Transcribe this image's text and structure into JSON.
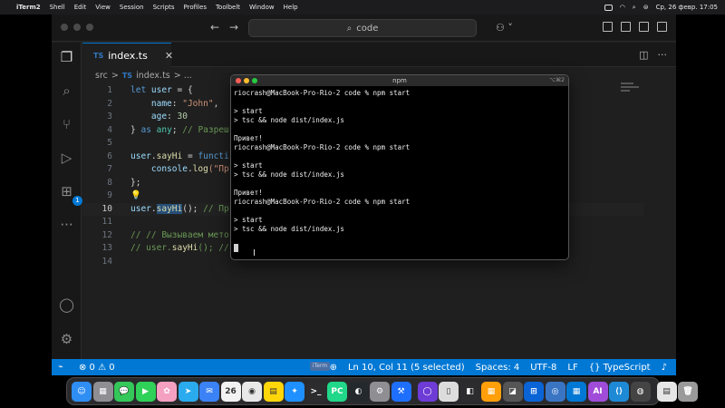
{
  "menubar": {
    "app": "iTerm2",
    "items": [
      "Shell",
      "Edit",
      "View",
      "Session",
      "Scripts",
      "Profiles",
      "Toolbelt",
      "Window",
      "Help"
    ],
    "datetime": "Ср, 26 февр.  17:05"
  },
  "vscode": {
    "command_center": "code",
    "tab": {
      "badge": "TS",
      "label": "index.ts",
      "close": "✕"
    },
    "breadcrumb": {
      "folder": "src",
      "sep": ">",
      "badge": "TS",
      "file": "index.ts",
      "rest": "> ..."
    },
    "activity_badge": "1"
  },
  "code_lines": [
    {
      "n": "1"
    },
    {
      "n": "2"
    },
    {
      "n": "3"
    },
    {
      "n": "4"
    },
    {
      "n": "5"
    },
    {
      "n": "6"
    },
    {
      "n": "7"
    },
    {
      "n": "8"
    },
    {
      "n": "9"
    },
    {
      "n": "10"
    },
    {
      "n": "11"
    },
    {
      "n": "12"
    },
    {
      "n": "13"
    },
    {
      "n": "14"
    }
  ],
  "code": {
    "l1_kw": "let",
    "l1_var": "user",
    "l1_pun": " = {",
    "l2_prop": "name",
    "l2_str": "\"John\"",
    "l3_prop": "age",
    "l3_num": "30",
    "l4_pun": "}",
    "l4_kw": "as",
    "l4_ty": "any",
    "l4_com": "// Разреш",
    "l6_var": "user",
    "l6_fn": "sayHi",
    "l6_kw": "functi",
    "l7_var": "console",
    "l7_fn": "log",
    "l7_str": "(\"Пр",
    "l8_pun": "};",
    "l9_bulb": "💡",
    "l10_var": "user",
    "l10_fn": "sayHi",
    "l10_pun": "();",
    "l10_com": "// Пр",
    "l12_com": "// // Вызываем мето",
    "l13_com": "// user.",
    "l13_fn": "sayHi",
    "l13_com2": "(); //"
  },
  "statusbar": {
    "remote_icon": "⌁",
    "problems": "⊗ 0 ⚠ 0",
    "position": "Ln 10, Col 11 (5 selected)",
    "spaces": "Spaces: 4",
    "encoding": "UTF-8",
    "eol": "LF",
    "language": "{} TypeScript",
    "bell": "🔔"
  },
  "terminal": {
    "title": "npm",
    "shortcut": "⌥⌘2",
    "lines": [
      "riocrash@MacBook-Pro-Rio-2 code % npm start",
      "",
      "> start",
      "> tsc && node dist/index.js",
      "",
      "Привет!",
      "riocrash@MacBook-Pro-Rio-2 code % npm start",
      "",
      "> start",
      "> tsc && node dist/index.js",
      "",
      "Привет!",
      "riocrash@MacBook-Pro-Rio-2 code % npm start",
      "",
      "> start",
      "> tsc && node dist/index.js",
      ""
    ]
  },
  "overlay_label": "iTerm",
  "dock": {
    "apps": [
      {
        "name": "finder",
        "color": "#2f8ef4",
        "glyph": "☺"
      },
      {
        "name": "launchpad",
        "color": "#8e8e93",
        "glyph": "▦"
      },
      {
        "name": "messages",
        "color": "#34c759",
        "glyph": "💬"
      },
      {
        "name": "facetime",
        "color": "#30d158",
        "glyph": "▶"
      },
      {
        "name": "photos",
        "color": "#f4a0c0",
        "glyph": "✿"
      },
      {
        "name": "telegram",
        "color": "#2aabee",
        "glyph": "➤"
      },
      {
        "name": "mail",
        "color": "#3b82f6",
        "glyph": "✉"
      },
      {
        "name": "calendar",
        "color": "#f2f2f2",
        "glyph": "26"
      },
      {
        "name": "chrome",
        "color": "#e8e8e8",
        "glyph": "◉"
      },
      {
        "name": "notes",
        "color": "#ffd60a",
        "glyph": "▤"
      },
      {
        "name": "safari",
        "color": "#1e90ff",
        "glyph": "✦"
      },
      {
        "name": "terminal",
        "color": "#2c2c2e",
        "glyph": ">_"
      },
      {
        "name": "pycharm",
        "color": "#21d789",
        "glyph": "PC"
      },
      {
        "name": "github",
        "color": "#24292e",
        "glyph": "◐"
      },
      {
        "name": "settings",
        "color": "#8e8e93",
        "glyph": "⚙"
      },
      {
        "name": "xcode-instruments",
        "color": "#1f6fff",
        "glyph": "⚒"
      },
      {
        "name": "sep1",
        "color": "",
        "glyph": ""
      },
      {
        "name": "app-purple",
        "color": "#6e3bd6",
        "glyph": "◯"
      },
      {
        "name": "preview",
        "color": "#dcdcdc",
        "glyph": "▯"
      },
      {
        "name": "app-dark",
        "color": "#2c2c2e",
        "glyph": "◧"
      },
      {
        "name": "app-orange",
        "color": "#ff9f0a",
        "glyph": "▦"
      },
      {
        "name": "app-gray",
        "color": "#555555",
        "glyph": "◪"
      },
      {
        "name": "windows",
        "color": "#0a64d6",
        "glyph": "⊞"
      },
      {
        "name": "app-blue",
        "color": "#3a75c4",
        "glyph": "◎"
      },
      {
        "name": "app-grid",
        "color": "#0078d4",
        "glyph": "▦"
      },
      {
        "name": "chatgpt",
        "color": "#a04cd9",
        "glyph": "AI"
      },
      {
        "name": "vscode",
        "color": "#1e8ad6",
        "glyph": "⟨⟩"
      },
      {
        "name": "app-red",
        "color": "#444444",
        "glyph": "◍"
      },
      {
        "name": "sep2",
        "color": "",
        "glyph": ""
      },
      {
        "name": "documents",
        "color": "#e6e6e6",
        "glyph": "▤"
      },
      {
        "name": "trash",
        "color": "#9a9a9a",
        "glyph": "🗑"
      }
    ]
  }
}
